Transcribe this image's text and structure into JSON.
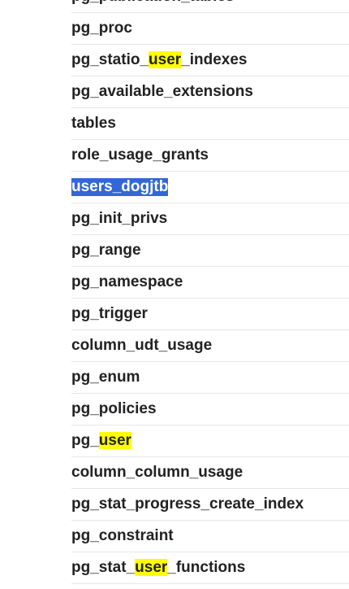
{
  "highlight_color": "#ffff00",
  "selection_color": "#3367d6",
  "rows": [
    {
      "segments": [
        {
          "text": "pg_publication_tables",
          "hl": false
        }
      ]
    },
    {
      "segments": [
        {
          "text": "pg_proc",
          "hl": false
        }
      ]
    },
    {
      "segments": [
        {
          "text": "pg_statio_",
          "hl": false
        },
        {
          "text": "user",
          "hl": true
        },
        {
          "text": "_indexes",
          "hl": false
        }
      ]
    },
    {
      "segments": [
        {
          "text": "pg_available_extensions",
          "hl": false
        }
      ]
    },
    {
      "segments": [
        {
          "text": "tables",
          "hl": false
        }
      ]
    },
    {
      "segments": [
        {
          "text": "role_usage_grants",
          "hl": false
        }
      ]
    },
    {
      "selected": true,
      "segments": [
        {
          "text": "users_dogjtb",
          "hl": false
        }
      ]
    },
    {
      "segments": [
        {
          "text": "pg_init_privs",
          "hl": false
        }
      ]
    },
    {
      "segments": [
        {
          "text": "pg_range",
          "hl": false
        }
      ]
    },
    {
      "segments": [
        {
          "text": "pg_namespace",
          "hl": false
        }
      ]
    },
    {
      "segments": [
        {
          "text": "pg_trigger",
          "hl": false
        }
      ]
    },
    {
      "segments": [
        {
          "text": "column_udt_usage",
          "hl": false
        }
      ]
    },
    {
      "segments": [
        {
          "text": "pg_enum",
          "hl": false
        }
      ]
    },
    {
      "segments": [
        {
          "text": "pg_policies",
          "hl": false
        }
      ]
    },
    {
      "segments": [
        {
          "text": "pg_",
          "hl": false
        },
        {
          "text": "user",
          "hl": true
        }
      ]
    },
    {
      "segments": [
        {
          "text": "column_column_usage",
          "hl": false
        }
      ]
    },
    {
      "segments": [
        {
          "text": "pg_stat_progress_create_index",
          "hl": false
        }
      ]
    },
    {
      "segments": [
        {
          "text": "pg_constraint",
          "hl": false
        }
      ]
    },
    {
      "segments": [
        {
          "text": "pg_stat_",
          "hl": false
        },
        {
          "text": "user",
          "hl": true
        },
        {
          "text": "_functions",
          "hl": false
        }
      ]
    }
  ]
}
